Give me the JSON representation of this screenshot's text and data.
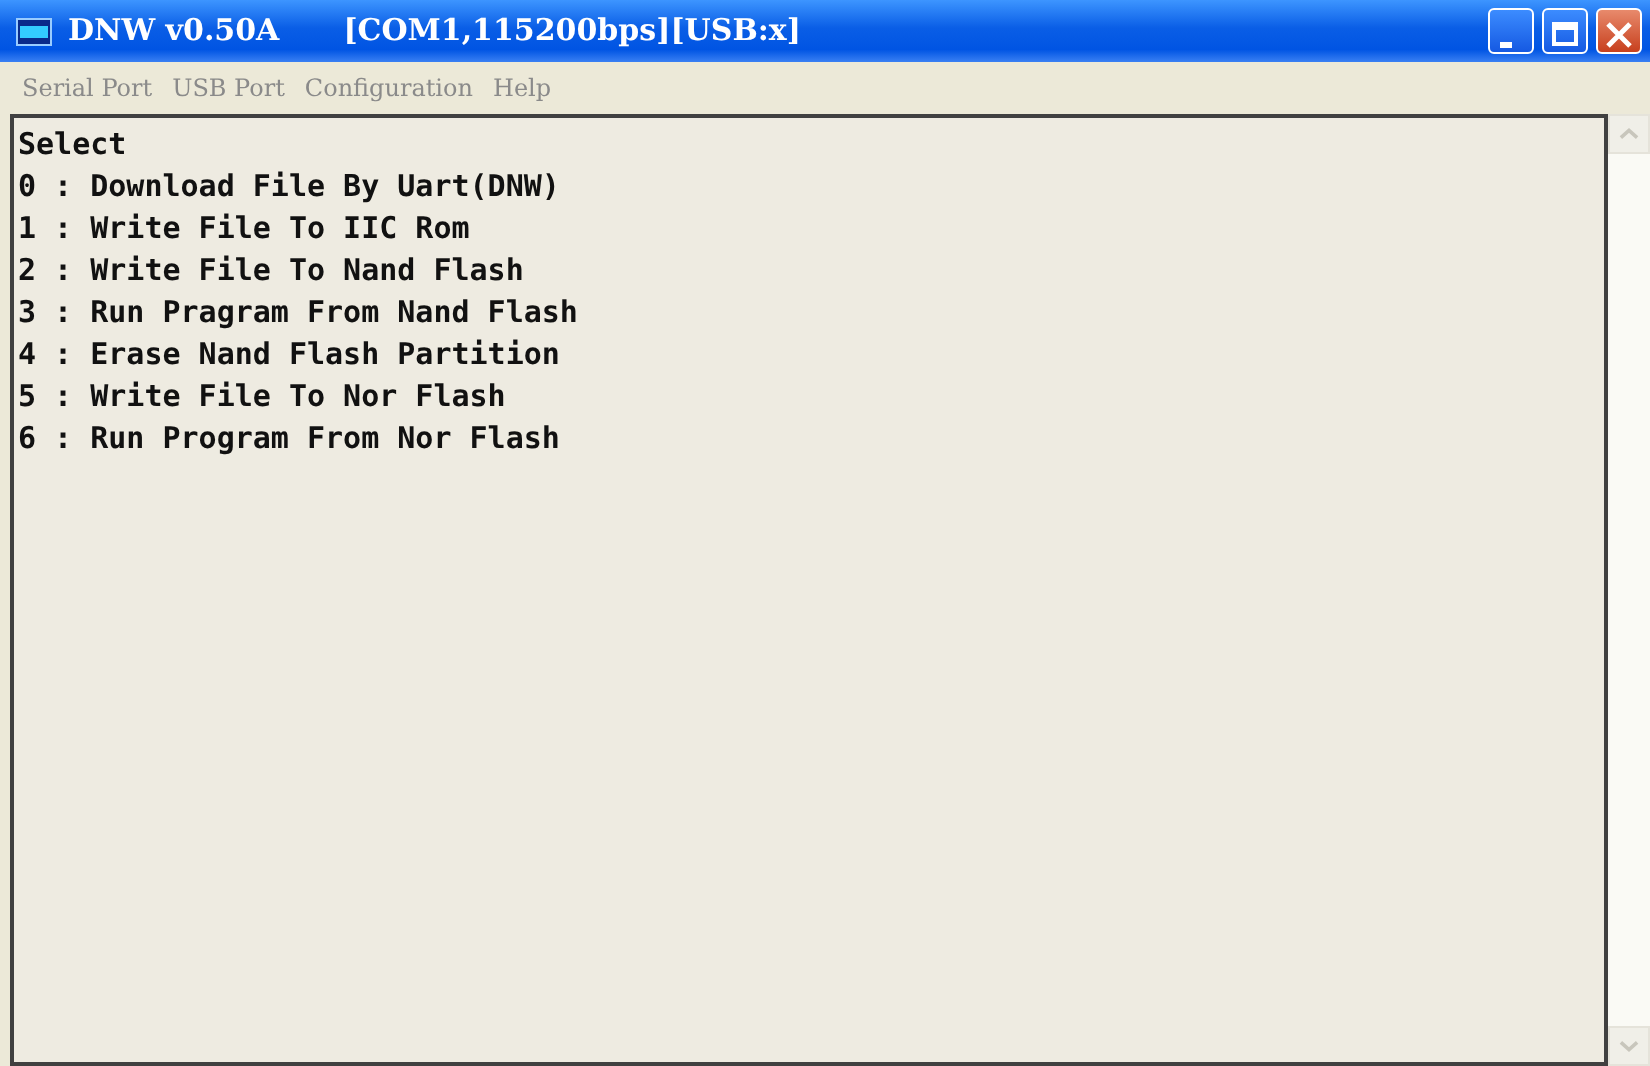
{
  "window": {
    "title": "DNW v0.50A",
    "status": "[COM1,115200bps][USB:x]"
  },
  "menu": [
    "Serial Port",
    "USB Port",
    "Configuration",
    "Help"
  ],
  "terminal": {
    "lines": [
      "Select",
      "0 : Download File By Uart(DNW)",
      "1 : Write File To IIC Rom",
      "2 : Write File To Nand Flash",
      "3 : Run Pragram From Nand Flash",
      "4 : Erase Nand Flash Partition",
      "5 : Write File To Nor Flash",
      "6 : Run Program From Nor Flash"
    ]
  }
}
